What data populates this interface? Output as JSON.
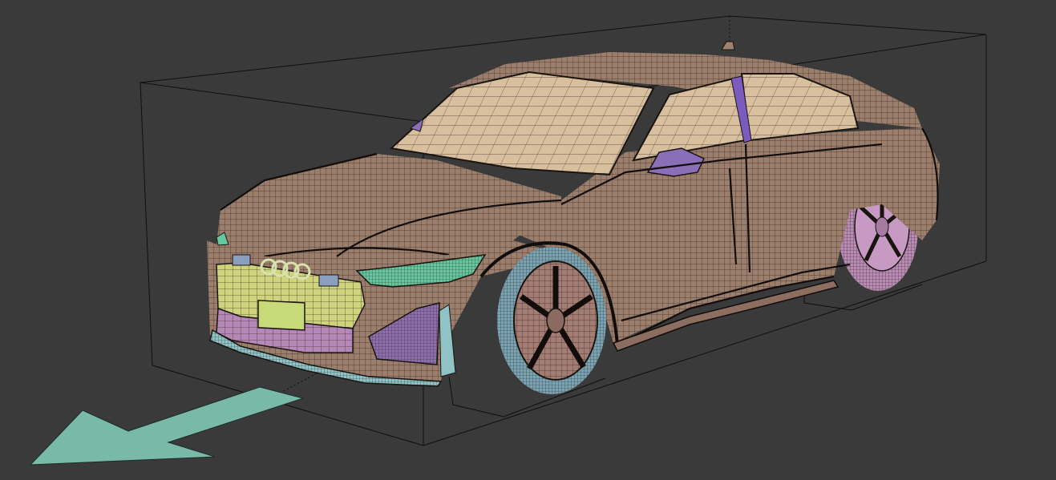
{
  "viewport": {
    "background": "#3a3a3a",
    "bounding_box_color": "#0e0e0e",
    "mesh_line_color": "#1a1411"
  },
  "model": {
    "body_color": "#9c7e6c",
    "glass_color": "#d8bf9e",
    "grille_color": "#cfd37e",
    "lower_grille_color": "#b588b9",
    "headlight_color": "#66c79e",
    "intake_color": "#8d6fae",
    "splitter_color": "#8fc3c6",
    "pillar_color": "#7b5bbd",
    "mirror_color": "#8a6eb8",
    "front_wheel_rim_color": "#a37d73",
    "front_tire_color": "#7aa3b3",
    "rear_wheel_color": "#b98bb5",
    "plate_color": "#c8d978",
    "logo_color": "#d7e2ad"
  },
  "direction_arrow": {
    "color": "#79b9a8",
    "icon": "forward-direction-arrow-icon"
  }
}
